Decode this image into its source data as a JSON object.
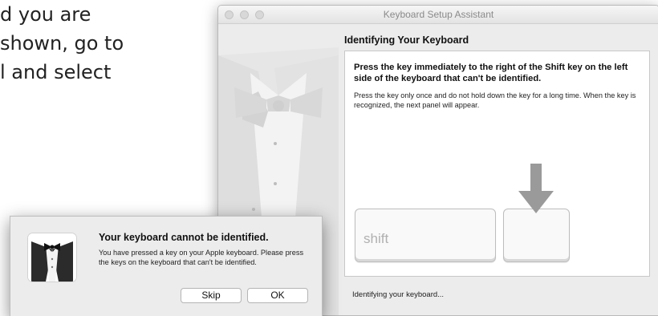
{
  "article": {
    "lines": [
      "d you are",
      "shown, go to",
      "l and select"
    ]
  },
  "window": {
    "title": "Keyboard Setup Assistant",
    "heading": "Identifying Your Keyboard",
    "instruction": "Press the key immediately to the right of the Shift key on the left side of the keyboard that can't be identified.",
    "detail": "Press the key only once and do not hold down the key for a long time. When the key is recognized, the next panel will appear.",
    "shift_key_label": "shift",
    "status": "Identifying your keyboard..."
  },
  "alert": {
    "title": "Your keyboard cannot be identified.",
    "message": "You have pressed a key on your Apple keyboard. Please press the keys on the keyboard that can't be identified.",
    "skip_label": "Skip",
    "ok_label": "OK"
  },
  "colors": {
    "window_bg": "#ececec",
    "panel_bg": "#ffffff",
    "arrow": "#9a9a9a"
  }
}
